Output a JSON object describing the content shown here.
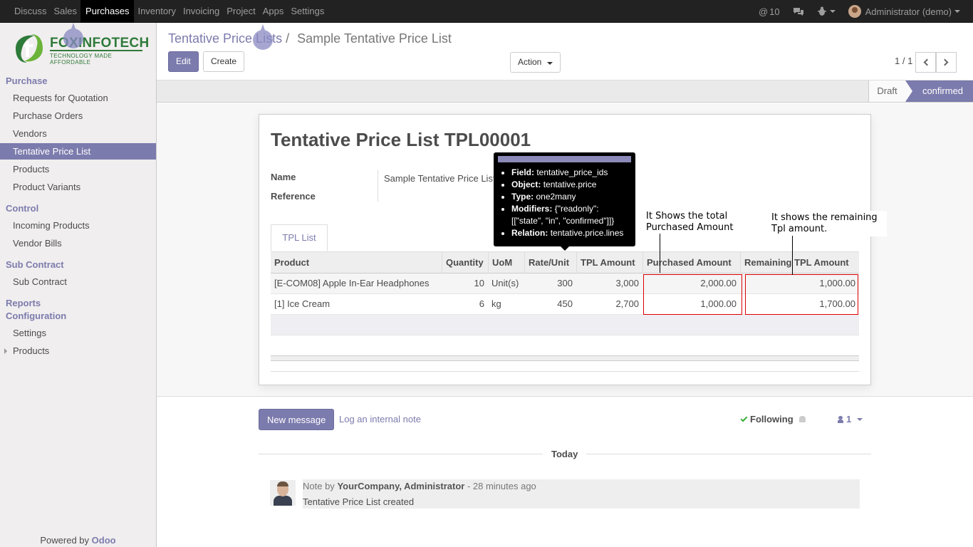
{
  "topnav": {
    "items": [
      "Discuss",
      "Sales",
      "Purchases",
      "Inventory",
      "Invoicing",
      "Project",
      "Apps",
      "Settings"
    ],
    "active_index": 2,
    "mentions": "10",
    "user": "Administrator (demo)"
  },
  "sidebar": {
    "logo_text": "FOXINFOTECH",
    "logo_tagline": "TECHNOLOGY MADE AFFORDABLE",
    "sections": [
      {
        "head": "Purchase",
        "items": [
          "Requests for Quotation",
          "Purchase Orders",
          "Vendors",
          "Tentative Price List",
          "Products",
          "Product Variants"
        ]
      },
      {
        "head": "Control",
        "items": [
          "Incoming Products",
          "Vendor Bills"
        ]
      },
      {
        "head": "Sub Contract",
        "items": [
          "Sub Contract"
        ]
      },
      {
        "head": "Reports",
        "items": []
      },
      {
        "head": "Configuration",
        "items": [
          "Settings",
          "Products"
        ]
      }
    ],
    "active_item": "Tentative Price List",
    "powered_by": "Powered by",
    "powered_brand": "Odoo"
  },
  "control_panel": {
    "breadcrumb_parent": "Tentative Price Lists",
    "breadcrumb_sep": "/",
    "breadcrumb_current": "Sample Tentative Price List",
    "edit_label": "Edit",
    "create_label": "Create",
    "action_label": "Action",
    "pager": "1 / 1"
  },
  "status": {
    "stages": [
      "Draft",
      "confirmed"
    ],
    "current": "confirmed"
  },
  "form": {
    "title": "Tentative Price List TPL00001",
    "name_label": "Name",
    "name_value": "Sample Tentative Price List",
    "reference_label": "Reference",
    "tab_label": "TPL List",
    "columns": [
      "Product",
      "Quantity",
      "UoM",
      "Rate/Unit",
      "TPL Amount",
      "Purchased Amount",
      "Remaining TPL Amount"
    ],
    "rows": [
      {
        "product": "[E-COM08] Apple In-Ear Headphones",
        "quantity": "10",
        "uom": "Unit(s)",
        "rate": "300",
        "tpl_amount": "3,000",
        "purchased": "2,000.00",
        "remaining": "1,000.00"
      },
      {
        "product": "[1] Ice Cream",
        "quantity": "6",
        "uom": "kg",
        "rate": "450",
        "tpl_amount": "2,700",
        "purchased": "1,000.00",
        "remaining": "1,700.00"
      }
    ]
  },
  "tooltip": {
    "field_label": "Field:",
    "field_value": "tentative_price_ids",
    "object_label": "Object:",
    "object_value": "tentative.price",
    "type_label": "Type:",
    "type_value": "one2many",
    "modifiers_label": "Modifiers:",
    "modifiers_value": "{\"readonly\": [[\"state\", \"in\", \"confirmed\"]]}",
    "relation_label": "Relation:",
    "relation_value": "tentative.price.lines"
  },
  "annotations": {
    "purchased_note": "It Shows the total Purchased Amount",
    "remaining_note": "It shows the remaining Tpl amount."
  },
  "chatter": {
    "new_message": "New message",
    "log_note": "Log an internal note",
    "following": "Following",
    "followers_count": "1",
    "today": "Today",
    "msg_prefix": "Note by",
    "msg_author": "YourCompany, Administrator",
    "msg_time": "- 28 minutes ago",
    "msg_body": "Tentative Price List created"
  },
  "colors": {
    "brand": "#7c7bad",
    "topbar": "#222222",
    "highlight_box": "#dd0000"
  }
}
